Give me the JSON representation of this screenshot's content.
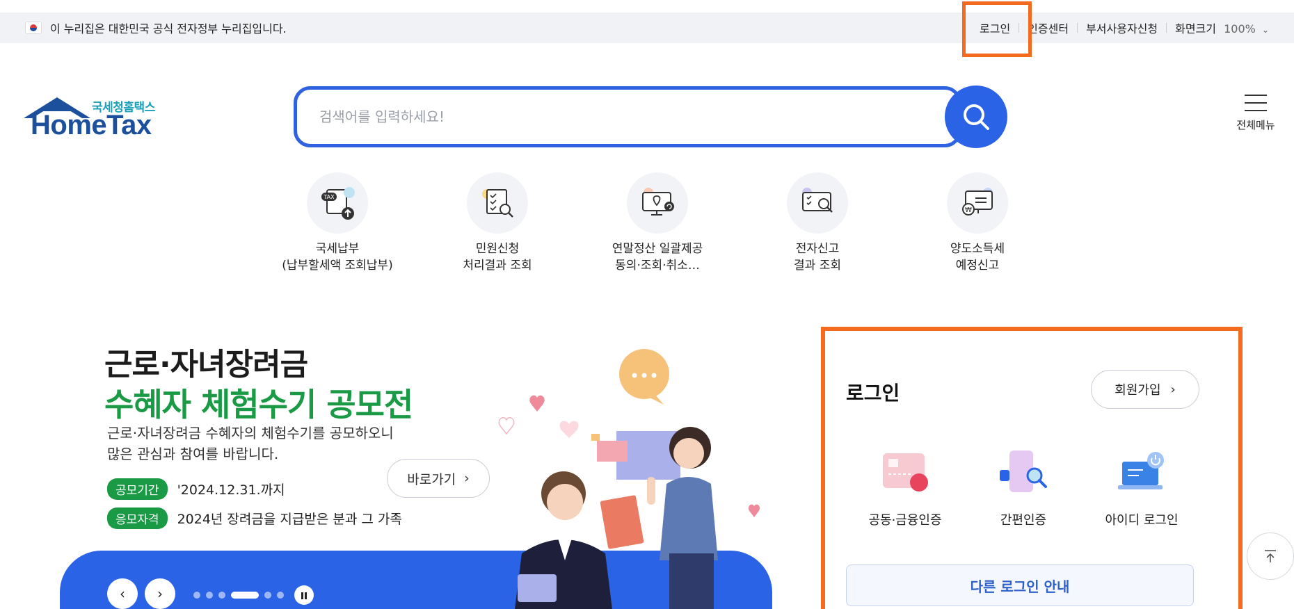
{
  "gov_bar": {
    "notice": "이 누리집은 대한민국 공식 전자정부 누리집입니다.",
    "flag_icon": "korea-flag-icon"
  },
  "util_menu": {
    "login": "로그인",
    "cert_center": "인증센터",
    "dept_user": "부서사용자신청",
    "zoom_label": "화면크기",
    "zoom_value": "100%"
  },
  "logo": {
    "sub": "국세청홈택스",
    "main": "HomeTax"
  },
  "search": {
    "placeholder": "검색어를 입력하세요!"
  },
  "all_menu": {
    "label": "전체메뉴"
  },
  "quick_menu": [
    {
      "line1": "국세납부",
      "line2": "(납부할세액 조회납부)",
      "icon": "tax-upload-icon"
    },
    {
      "line1": "민원신청",
      "line2": "처리결과 조회",
      "icon": "document-search-icon"
    },
    {
      "line1": "연말정산 일괄제공",
      "line2": "동의·조회·취소…",
      "icon": "monitor-location-icon"
    },
    {
      "line1": "전자신고",
      "line2": "결과 조회",
      "icon": "monitor-search-icon"
    },
    {
      "line1": "양도소득세",
      "line2": "예정신고",
      "icon": "monitor-won-icon"
    }
  ],
  "banner": {
    "title1": "근로·자녀장려금",
    "title2": "수혜자 체험수기 공모전",
    "desc1": "근로·자녀장려금 수혜자의 체험수기를 공모하오니",
    "desc2": "많은 관심과 참여를 바랍니다.",
    "period_tag": "공모기간",
    "period_value": "'2024.12.31.까지",
    "qual_tag": "응모자격",
    "qual_value": "2024년 장려금을 지급받은 분과 그 가족",
    "goto_label": "바로가기"
  },
  "slider": {
    "total": 6,
    "active": 4
  },
  "login_panel": {
    "title": "로그인",
    "join": "회원가입",
    "methods": [
      {
        "label": "공동·금융인증",
        "icon": "certificate-card-icon"
      },
      {
        "label": "간편인증",
        "icon": "phone-search-icon"
      },
      {
        "label": "아이디 로그인",
        "icon": "laptop-power-icon"
      }
    ],
    "other": "다른 로그인 안내"
  },
  "colors": {
    "accent_blue": "#2b63e6",
    "brand_green": "#1a9a44",
    "highlight_orange": "#f46a1f"
  }
}
